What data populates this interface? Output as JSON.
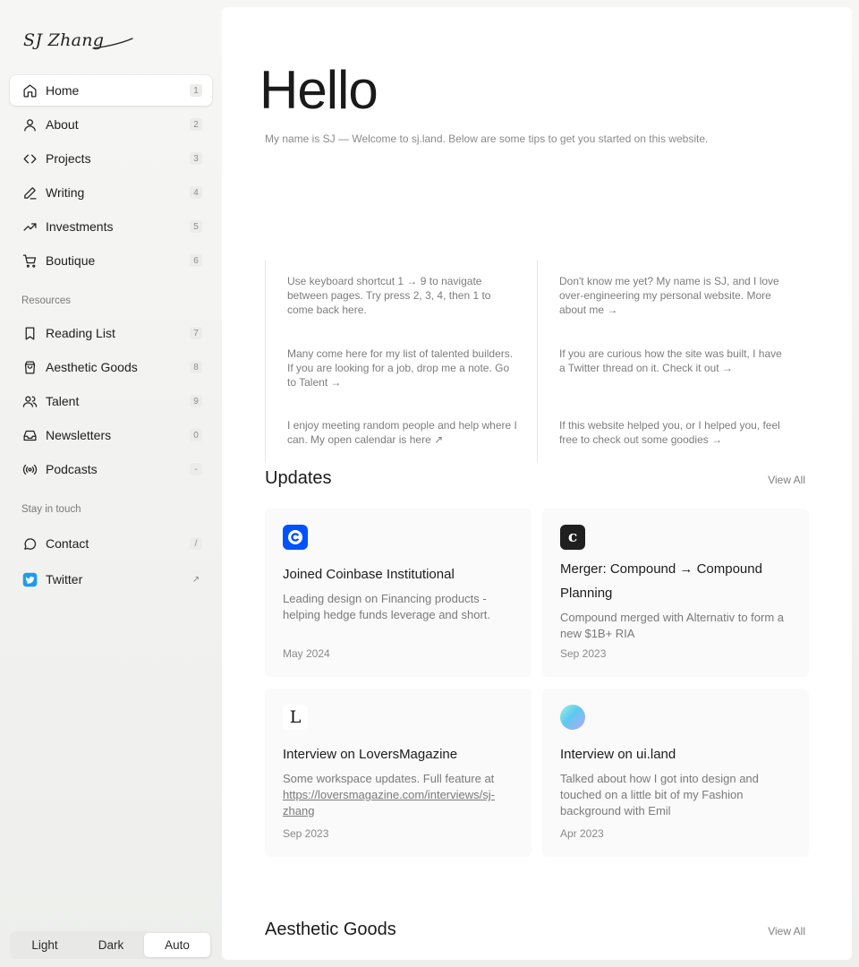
{
  "logo": {
    "text": "SJ Zhang"
  },
  "nav": {
    "main": [
      {
        "label": "Home",
        "key": "1",
        "icon": "home-icon"
      },
      {
        "label": "About",
        "key": "2",
        "icon": "user-icon"
      },
      {
        "label": "Projects",
        "key": "3",
        "icon": "code-icon"
      },
      {
        "label": "Writing",
        "key": "4",
        "icon": "pen-icon"
      },
      {
        "label": "Investments",
        "key": "5",
        "icon": "trending-up-icon"
      },
      {
        "label": "Boutique",
        "key": "6",
        "icon": "cart-icon"
      }
    ],
    "resources_title": "Resources",
    "resources": [
      {
        "label": "Reading List",
        "key": "7",
        "icon": "bookmark-icon"
      },
      {
        "label": "Aesthetic Goods",
        "key": "8",
        "icon": "shopping-bag-icon"
      },
      {
        "label": "Talent",
        "key": "9",
        "icon": "users-icon"
      },
      {
        "label": "Newsletters",
        "key": "0",
        "icon": "inbox-icon"
      },
      {
        "label": "Podcasts",
        "key": "-",
        "icon": "broadcast-icon"
      }
    ],
    "touch_title": "Stay in touch",
    "touch": [
      {
        "label": "Contact",
        "key": "/",
        "icon": "message-circle-icon"
      },
      {
        "label": "Twitter",
        "key": "↗",
        "icon": "twitter-icon"
      }
    ]
  },
  "theme": {
    "light": "Light",
    "dark": "Dark",
    "auto": "Auto",
    "selected": "Auto"
  },
  "hero": {
    "title": "Hello",
    "intro": "My name is SJ — Welcome to sj.land. Below are some tips to get you started on this website."
  },
  "tips": {
    "left": [
      "Use keyboard shortcut 1 → 9 to navigate between pages. Try press 2, 3, 4, then 1 to come back here.",
      "Many come here for my list of talented builders. If you are looking for a job, drop me a note. Go to Talent →",
      "I enjoy meeting random people and help where I can. My open calendar is here ↗"
    ],
    "right": [
      "Don't know me yet? My name is SJ, and I love over-engineering my personal website. More about me →",
      "If you are curious how the site was built, I have a Twitter thread on it. Check it out →",
      "If this website helped you, or I helped you, feel free to check out some goodies →"
    ]
  },
  "updates": {
    "title": "Updates",
    "view_all": "View All",
    "cards": [
      {
        "title": "Joined Coinbase Institutional",
        "desc": "Leading design on Financing products - helping hedge funds leverage and short.",
        "date": "May 2024",
        "icon": "coinbase-logo-icon"
      },
      {
        "title": "Merger: Compound → Compound Planning",
        "desc": "Compound merged with Alternativ to form a new $1B+ RIA",
        "date": "Sep 2023",
        "icon": "compound-logo-icon"
      },
      {
        "title": "Interview on LoversMagazine",
        "desc": "Some workspace updates. Full feature at ",
        "link": "https://loversmagazine.com/interviews/sj-zhang",
        "date": "Sep 2023",
        "icon": "loversmagazine-logo-icon",
        "logo_letter": "L"
      },
      {
        "title": "Interview on ui.land",
        "desc": "Talked about how I got into design and touched on a little bit of my Fashion background with Emil",
        "date": "Apr 2023",
        "icon": "uiland-logo-icon"
      }
    ]
  },
  "goods": {
    "title": "Aesthetic Goods",
    "view_all": "View All"
  },
  "colors": {
    "coinbase": "#0052ff",
    "compound": "#1f1f1f",
    "accent_twitter": "#1d9bf0"
  }
}
